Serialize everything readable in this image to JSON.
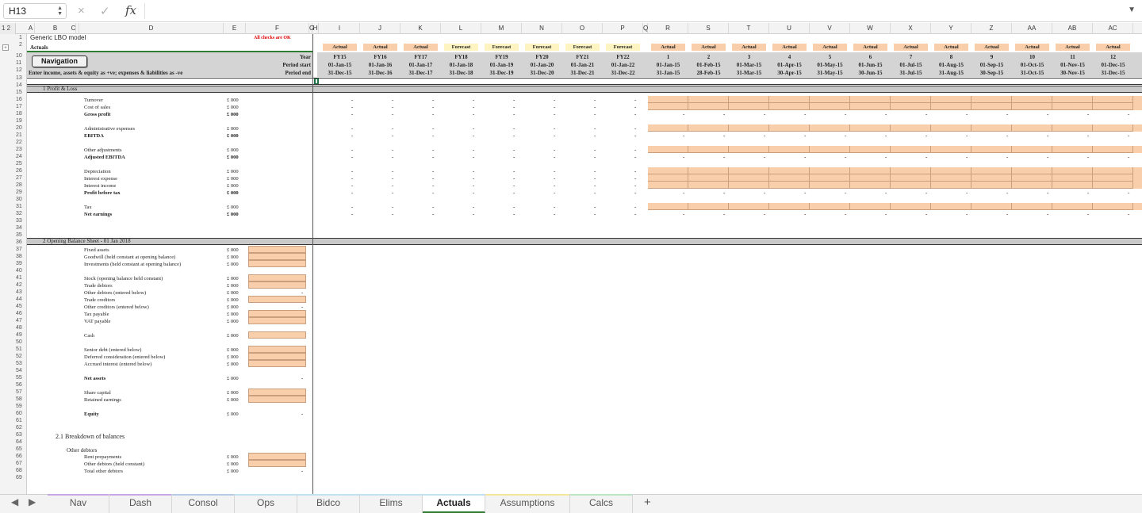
{
  "namebox": "H13",
  "formula_icons": {
    "cancel": "×",
    "confirm": "✓",
    "fx": "fx"
  },
  "outline_levels": "1 2",
  "columns": [
    "A",
    "B",
    "C",
    "D",
    "E",
    "F",
    "G",
    "H",
    "I",
    "J",
    "K",
    "L",
    "M",
    "N",
    "O",
    "P",
    "Q",
    "R",
    "S",
    "T",
    "U",
    "V",
    "W",
    "X",
    "Y",
    "Z",
    "AA",
    "AB",
    "AC"
  ],
  "rows": [
    "1",
    "2",
    "10",
    "11",
    "12",
    "13",
    "14",
    "15",
    "16",
    "17",
    "18",
    "19",
    "20",
    "21",
    "22",
    "23",
    "24",
    "25",
    "26",
    "27",
    "28",
    "29",
    "30",
    "31",
    "32",
    "33",
    "34",
    "35",
    "36",
    "37",
    "38",
    "39",
    "40",
    "41",
    "42",
    "43",
    "44",
    "45",
    "46",
    "47",
    "48",
    "49",
    "50",
    "51",
    "52",
    "53",
    "54",
    "55",
    "56",
    "57",
    "58",
    "59",
    "60",
    "61",
    "62",
    "63",
    "64",
    "65",
    "66",
    "67",
    "68",
    "69"
  ],
  "title": "Generic LBO model",
  "sheet_label": "Actuals",
  "checks": "All checks are OK",
  "nav_button": "Navigation",
  "instruction": "Enter income, assets & equity as +ve; expenses & liabilities as -ve",
  "row_labels": {
    "year": "Year",
    "period_start": "Period start",
    "period_end": "Period end"
  },
  "annual": [
    {
      "badge": "Actual",
      "year": "FY15",
      "start": "01-Jan-15",
      "end": "31-Dec-15"
    },
    {
      "badge": "Actual",
      "year": "FY16",
      "start": "01-Jan-16",
      "end": "31-Dec-16"
    },
    {
      "badge": "Actual",
      "year": "FY17",
      "start": "01-Jan-17",
      "end": "31-Dec-17"
    },
    {
      "badge": "Forecast",
      "year": "FY18",
      "start": "01-Jan-18",
      "end": "31-Dec-18"
    },
    {
      "badge": "Forecast",
      "year": "FY19",
      "start": "01-Jan-19",
      "end": "31-Dec-19"
    },
    {
      "badge": "Forecast",
      "year": "FY20",
      "start": "01-Jan-20",
      "end": "31-Dec-20"
    },
    {
      "badge": "Forecast",
      "year": "FY21",
      "start": "01-Jan-21",
      "end": "31-Dec-21"
    },
    {
      "badge": "Forecast",
      "year": "FY22",
      "start": "01-Jan-22",
      "end": "31-Dec-22"
    }
  ],
  "monthly": [
    {
      "badge": "Actual",
      "num": "1",
      "start": "01-Jan-15",
      "end": "31-Jan-15"
    },
    {
      "badge": "Actual",
      "num": "2",
      "start": "01-Feb-15",
      "end": "28-Feb-15"
    },
    {
      "badge": "Actual",
      "num": "3",
      "start": "01-Mar-15",
      "end": "31-Mar-15"
    },
    {
      "badge": "Actual",
      "num": "4",
      "start": "01-Apr-15",
      "end": "30-Apr-15"
    },
    {
      "badge": "Actual",
      "num": "5",
      "start": "01-May-15",
      "end": "31-May-15"
    },
    {
      "badge": "Actual",
      "num": "6",
      "start": "01-Jun-15",
      "end": "30-Jun-15"
    },
    {
      "badge": "Actual",
      "num": "7",
      "start": "01-Jul-15",
      "end": "31-Jul-15"
    },
    {
      "badge": "Actual",
      "num": "8",
      "start": "01-Aug-15",
      "end": "31-Aug-15"
    },
    {
      "badge": "Actual",
      "num": "9",
      "start": "01-Sep-15",
      "end": "30-Sep-15"
    },
    {
      "badge": "Actual",
      "num": "10",
      "start": "01-Oct-15",
      "end": "31-Oct-15"
    },
    {
      "badge": "Actual",
      "num": "11",
      "start": "01-Nov-15",
      "end": "30-Nov-15"
    },
    {
      "badge": "Actual",
      "num": "12",
      "start": "01-Dec-15",
      "end": "31-Dec-15"
    }
  ],
  "section1": "1  Profit & Loss",
  "pl_rows": [
    {
      "label": "Turnover",
      "unit": "£ 000",
      "bold": false,
      "input": true,
      "r": 16
    },
    {
      "label": "Cost of sales",
      "unit": "£ 000",
      "bold": false,
      "input": true,
      "r": 17
    },
    {
      "label": "Gross profit",
      "unit": "£ 000",
      "bold": true,
      "input": false,
      "r": 18
    },
    {
      "label": "Administrative expenses",
      "unit": "£ 000",
      "bold": false,
      "input": true,
      "r": 20
    },
    {
      "label": "EBITDA",
      "unit": "£ 000",
      "bold": true,
      "input": false,
      "r": 21
    },
    {
      "label": "Other adjustments",
      "unit": "£ 000",
      "bold": false,
      "input": true,
      "r": 23
    },
    {
      "label": "Adjusted EBITDA",
      "unit": "£ 000",
      "bold": true,
      "input": false,
      "r": 24
    },
    {
      "label": "Depreciation",
      "unit": "£ 000",
      "bold": false,
      "input": true,
      "r": 26
    },
    {
      "label": "Interest expense",
      "unit": "£ 000",
      "bold": false,
      "input": true,
      "r": 27
    },
    {
      "label": "Interest income",
      "unit": "£ 000",
      "bold": false,
      "input": true,
      "r": 28
    },
    {
      "label": "Profit before tax",
      "unit": "£ 000",
      "bold": true,
      "input": false,
      "r": 29
    },
    {
      "label": "Tax",
      "unit": "£ 000",
      "bold": false,
      "input": true,
      "r": 31
    },
    {
      "label": "Net earnings",
      "unit": "£ 000",
      "bold": true,
      "input": false,
      "r": 32
    }
  ],
  "dash": "-",
  "section2": "2  Opening Balance Sheet - 01 Jan 2018",
  "bs_rows": [
    {
      "label": "Fixed assets",
      "unit": "£ 000",
      "bold": false,
      "input": true,
      "dash": false,
      "r": 37
    },
    {
      "label": "Goodwill (held constant at opening balance)",
      "unit": "£ 000",
      "bold": false,
      "input": true,
      "dash": false,
      "r": 38
    },
    {
      "label": "Investments (held constant at opening balance)",
      "unit": "£ 000",
      "bold": false,
      "input": true,
      "dash": false,
      "r": 39
    },
    {
      "label": "Stock (opening balance held constant)",
      "unit": "£ 000",
      "bold": false,
      "input": true,
      "dash": false,
      "r": 41
    },
    {
      "label": "Trade debtors",
      "unit": "£ 000",
      "bold": false,
      "input": true,
      "dash": false,
      "r": 42
    },
    {
      "label": "Other debtors (entered below)",
      "unit": "£ 000",
      "bold": false,
      "input": false,
      "dash": true,
      "r": 43
    },
    {
      "label": "Trade creditors",
      "unit": "£ 000",
      "bold": false,
      "input": true,
      "dash": false,
      "r": 44
    },
    {
      "label": "Other creditors (entered below)",
      "unit": "£ 000",
      "bold": false,
      "input": false,
      "dash": true,
      "r": 45
    },
    {
      "label": "Tax payable",
      "unit": "£ 000",
      "bold": false,
      "input": true,
      "dash": false,
      "r": 46
    },
    {
      "label": "VAT payable",
      "unit": "£ 000",
      "bold": false,
      "input": true,
      "dash": false,
      "r": 47
    },
    {
      "label": "Cash",
      "unit": "£ 000",
      "bold": false,
      "input": true,
      "dash": false,
      "r": 49
    },
    {
      "label": "Senior debt (entered below)",
      "unit": "£ 000",
      "bold": false,
      "input": true,
      "dash": false,
      "r": 51
    },
    {
      "label": "Deferred consideration (entered below)",
      "unit": "£ 000",
      "bold": false,
      "input": true,
      "dash": false,
      "r": 52
    },
    {
      "label": "Accrued interest (entered below)",
      "unit": "£ 000",
      "bold": false,
      "input": true,
      "dash": false,
      "r": 53
    },
    {
      "label": "Net assets",
      "unit": "£ 000",
      "bold": true,
      "input": false,
      "dash": true,
      "r": 55
    },
    {
      "label": "Share capital",
      "unit": "£ 000",
      "bold": false,
      "input": true,
      "dash": false,
      "r": 57
    },
    {
      "label": "Retained earnings",
      "unit": "£ 000",
      "bold": false,
      "input": true,
      "dash": false,
      "r": 58
    },
    {
      "label": "Equity",
      "unit": "£ 000",
      "bold": true,
      "input": false,
      "dash": true,
      "r": 60
    },
    {
      "label": "Rent prepayments",
      "unit": "£ 000",
      "bold": false,
      "input": true,
      "dash": false,
      "r": 66
    },
    {
      "label": "Other debtors (held constant)",
      "unit": "£ 000",
      "bold": false,
      "input": true,
      "dash": false,
      "r": 67
    },
    {
      "label": "Total other debtors",
      "unit": "£ 000",
      "bold": false,
      "input": false,
      "dash": true,
      "r": 68
    }
  ],
  "subsection21": "2.1  Breakdown of balances",
  "other_debtors_heading": "Other debtors",
  "tabs": [
    {
      "label": "Nav",
      "color": "#c9a7e4",
      "active": false
    },
    {
      "label": "Dash",
      "color": "#c9a7e4",
      "active": false
    },
    {
      "label": "Consol",
      "color": "#b3cde8",
      "active": false
    },
    {
      "label": "Ops",
      "color": "#bfe3f5",
      "active": false
    },
    {
      "label": "Bidco",
      "color": "#bfe3f5",
      "active": false
    },
    {
      "label": "Elims",
      "color": "#bfe3f5",
      "active": false
    },
    {
      "label": "Actuals",
      "color": "#bfe3f5",
      "active": true
    },
    {
      "label": "Assumptions",
      "color": "#f4e79b",
      "active": false
    },
    {
      "label": "Calcs",
      "color": "#b9e6c2",
      "active": false
    }
  ],
  "add_tab": "+",
  "colors": {
    "input": "#f8cfaa",
    "header_band": "#d4d4d4",
    "forecast_badge": "#fdf4c1",
    "checks_ok": "#e00000",
    "active_tab_underline": "#2e7d32"
  }
}
